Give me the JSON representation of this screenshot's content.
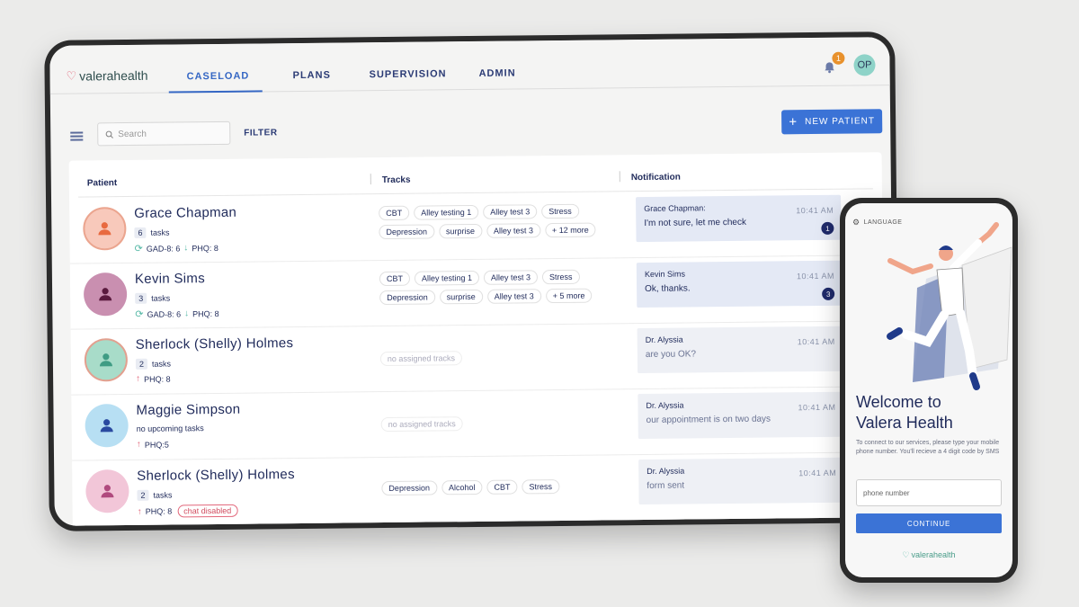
{
  "app": {
    "brand": "valerahealth",
    "nav": [
      {
        "label": "CASELOAD",
        "active": true
      },
      {
        "label": "PLANS",
        "active": false
      },
      {
        "label": "SUPERVISION",
        "active": false
      },
      {
        "label": "ADMIN",
        "active": false
      }
    ],
    "notification_count": "1",
    "user_initials": "OP"
  },
  "toolbar": {
    "search_placeholder": "Search",
    "filter_label": "FILTER",
    "new_patient_label": "NEW PATIENT"
  },
  "table": {
    "headers": {
      "patient": "Patient",
      "tracks": "Tracks",
      "notification": "Notification"
    },
    "rows": [
      {
        "name": "Grace Chapman",
        "tasks_count": "6",
        "tasks_label": "tasks",
        "scores": [
          "GAD-8: 6",
          "PHQ: 8"
        ],
        "tracks": [
          "CBT",
          "Alley testing 1",
          "Alley test 3",
          "Stress",
          "Depression",
          "surprise",
          "Alley test 3",
          "+ 12 more"
        ],
        "notif_sender": "Grace Chapman:",
        "notif_message": "I'm not sure, let me check",
        "notif_time": "10:41 AM",
        "notif_unread": "1"
      },
      {
        "name": "Kevin Sims",
        "tasks_count": "3",
        "tasks_label": "tasks",
        "scores": [
          "GAD-8: 6",
          "PHQ: 8"
        ],
        "tracks": [
          "CBT",
          "Alley testing 1",
          "Alley test 3",
          "Stress",
          "Depression",
          "surprise",
          "Alley test 3",
          "+ 5 more"
        ],
        "notif_sender": "Kevin Sims",
        "notif_message": "Ok, thanks.",
        "notif_time": "10:41 AM",
        "notif_unread": "3"
      },
      {
        "name": "Sherlock (Shelly) Holmes",
        "tasks_count": "2",
        "tasks_label": "tasks",
        "scores": [
          "PHQ: 8"
        ],
        "tracks_empty": "no assigned tracks",
        "notif_sender": "Dr. Alyssia",
        "notif_message": "are you OK?",
        "notif_time": "10:41 AM"
      },
      {
        "name": "Maggie Simpson",
        "tasks_label": "no upcoming tasks",
        "scores": [
          "PHQ:5"
        ],
        "tracks_empty": "no assigned tracks",
        "notif_sender": "Dr. Alyssia",
        "notif_message": "our appointment is on two days",
        "notif_time": "10:41 AM"
      },
      {
        "name": "Sherlock (Shelly) Holmes",
        "tasks_count": "2",
        "tasks_label": "tasks",
        "scores": [
          "PHQ: 8"
        ],
        "chat_status": "chat disabled",
        "tracks": [
          "Depression",
          "Alcohol",
          "CBT",
          "Stress"
        ],
        "notif_sender": "Dr. Alyssia",
        "notif_message": "form sent",
        "notif_time": "10:41 AM"
      }
    ]
  },
  "phone": {
    "language_label": "LANGUAGE",
    "welcome_line1": "Welcome to",
    "welcome_line2": "Valera Health",
    "instructions": "To connect to our services, please type your mobile phone number. You'll recieve a 4 digit code by SMS",
    "phone_placeholder": "phone number",
    "continue_label": "CONTINUE",
    "brand": "valerahealth"
  },
  "colors": {
    "primary": "#3b73d6",
    "navy": "#1f2a5a",
    "badge_orange": "#e8912c",
    "accent_teal": "#56b8a6",
    "accent_red": "#e2677b"
  }
}
